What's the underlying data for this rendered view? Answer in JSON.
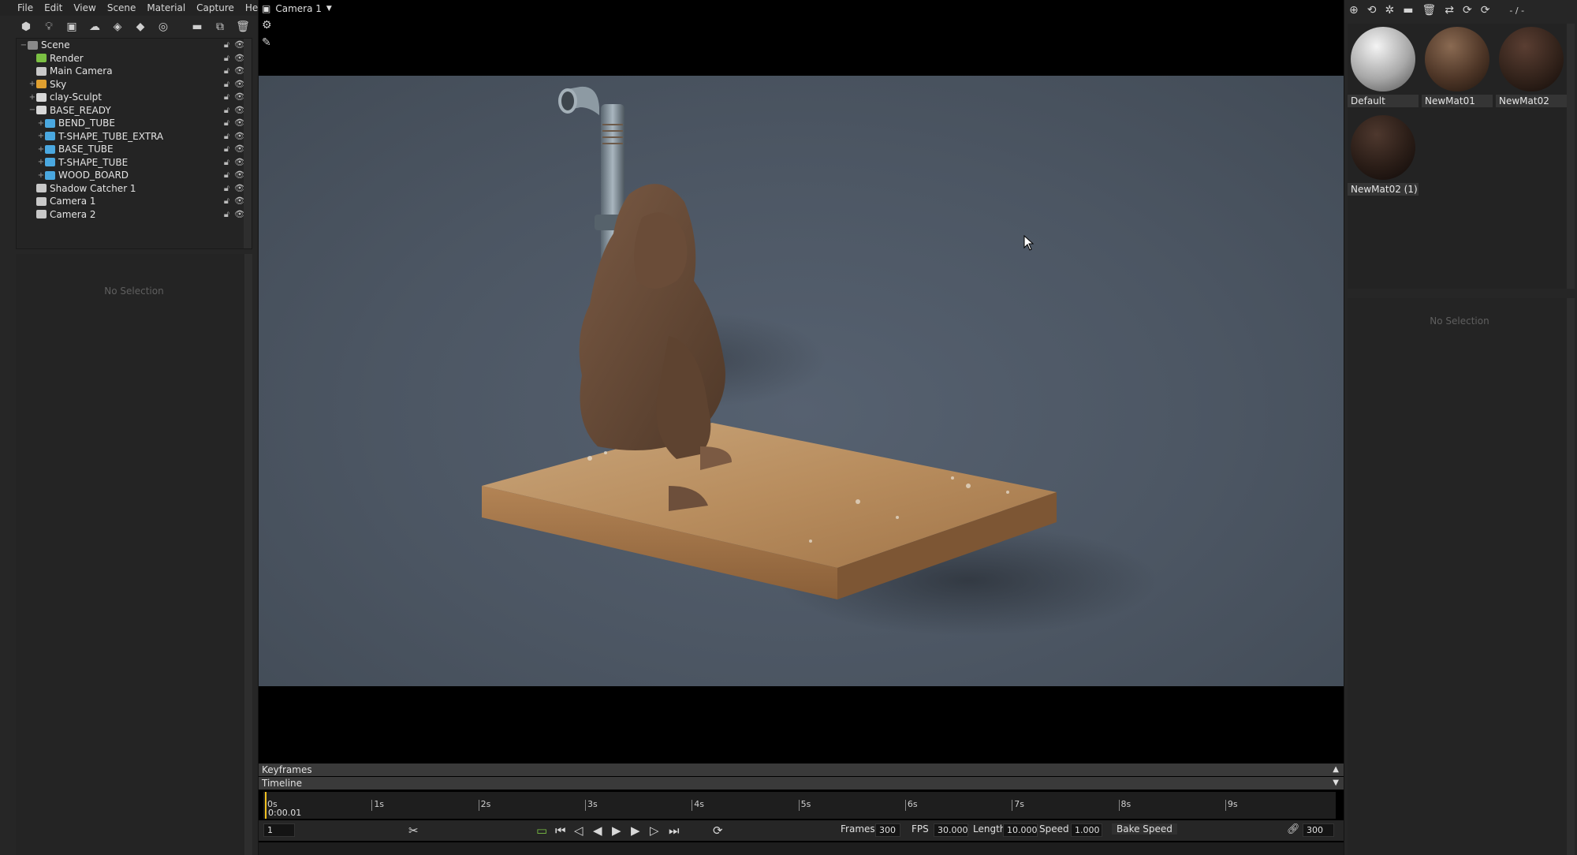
{
  "menu": [
    "File",
    "Edit",
    "View",
    "Scene",
    "Material",
    "Capture",
    "Help"
  ],
  "left_toolbar_icons": [
    "add-object-icon",
    "light-icon",
    "camera-icon",
    "sky-icon",
    "shadow-catcher-icon",
    "group-icon",
    "environment-icon",
    "folder-icon",
    "duplicate-icon",
    "delete-icon"
  ],
  "scene_tree": [
    {
      "label": "Scene",
      "level": 0,
      "exp": "−",
      "icon": "scene-icon",
      "color": "#8a8a8a"
    },
    {
      "label": "Render",
      "level": 1,
      "exp": "",
      "icon": "render-icon",
      "color": "#7bc043"
    },
    {
      "label": "Main Camera",
      "level": 1,
      "exp": "",
      "icon": "camera-icon",
      "color": "#c8c8c8"
    },
    {
      "label": "Sky",
      "level": 1,
      "exp": "+",
      "icon": "sky-icon",
      "color": "#e0a030"
    },
    {
      "label": "clay-Sculpt",
      "level": 1,
      "exp": "+",
      "icon": "mesh-icon",
      "color": "#d8d8d8"
    },
    {
      "label": "BASE_READY",
      "level": 1,
      "exp": "−",
      "icon": "mesh-icon",
      "color": "#d8d8d8"
    },
    {
      "label": "BEND_TUBE",
      "level": 2,
      "exp": "+",
      "icon": "cube-icon",
      "color": "#4aa8e0"
    },
    {
      "label": "T-SHAPE_TUBE_EXTRA",
      "level": 2,
      "exp": "+",
      "icon": "cube-icon",
      "color": "#4aa8e0"
    },
    {
      "label": "BASE_TUBE",
      "level": 2,
      "exp": "+",
      "icon": "cube-icon",
      "color": "#4aa8e0"
    },
    {
      "label": "T-SHAPE_TUBE",
      "level": 2,
      "exp": "+",
      "icon": "cube-icon",
      "color": "#4aa8e0"
    },
    {
      "label": "WOOD_BOARD",
      "level": 2,
      "exp": "+",
      "icon": "cube-icon",
      "color": "#4aa8e0"
    },
    {
      "label": "Shadow Catcher 1",
      "level": 1,
      "exp": "",
      "icon": "shadow-catcher-icon",
      "color": "#c8c8c8"
    },
    {
      "label": "Camera 1",
      "level": 1,
      "exp": "",
      "icon": "camera-icon",
      "color": "#c8c8c8"
    },
    {
      "label": "Camera 2",
      "level": 1,
      "exp": "",
      "icon": "camera-icon",
      "color": "#c8c8c8"
    }
  ],
  "left_panel": {
    "no_selection": "No Selection"
  },
  "viewport": {
    "camera_label": "Camera 1"
  },
  "timeline": {
    "keyframes_label": "Keyframes",
    "timeline_label": "Timeline",
    "ticks": [
      "0s",
      "1s",
      "2s",
      "3s",
      "4s",
      "5s",
      "6s",
      "7s",
      "8s",
      "9s"
    ],
    "time_readout": "0:00.01",
    "frame_field": "1",
    "frames_label": "Frames",
    "frames_value": "300",
    "fps_label": "FPS",
    "fps_value": "30.000",
    "length_label": "Length",
    "length_value": "10.000",
    "speed_label": "Speed",
    "speed_value": "1.000",
    "bake_speed_label": "Bake Speed",
    "end_frame_value": "300"
  },
  "right_toolbar_icons": [
    "add-material-icon",
    "copy-material-icon",
    "pick-material-icon",
    "folder-icon",
    "delete-icon",
    "shuffle-icon",
    "refresh-icon",
    "refresh-icon"
  ],
  "right_toolbar_text": "- / -",
  "materials": [
    {
      "name": "Default"
    },
    {
      "name": "NewMat01"
    },
    {
      "name": "NewMat02"
    },
    {
      "name": "NewMat02 (1)"
    }
  ],
  "right_panel": {
    "no_selection": "No Selection"
  }
}
